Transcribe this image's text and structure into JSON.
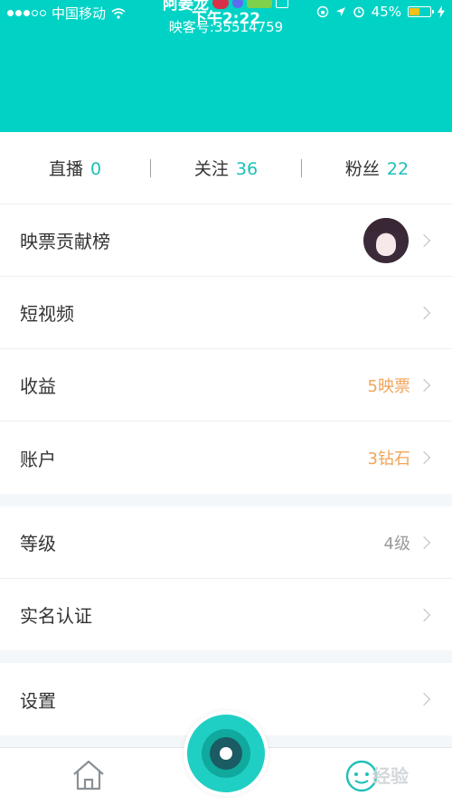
{
  "status_bar": {
    "carrier": "中国移动",
    "time": "下午2:22",
    "battery": "45%"
  },
  "profile": {
    "name": "阿姜龙",
    "id": "映客号:35514759"
  },
  "stats": [
    {
      "label": "直播",
      "value": "0"
    },
    {
      "label": "关注",
      "value": "36"
    },
    {
      "label": "粉丝",
      "value": "22"
    }
  ],
  "menu": {
    "contribution": {
      "label": "映票贡献榜"
    },
    "short_video": {
      "label": "短视频"
    },
    "earnings": {
      "label": "收益",
      "value": "5映票"
    },
    "account": {
      "label": "账户",
      "value": "3钻石"
    },
    "level": {
      "label": "等级",
      "value": "4级"
    },
    "verification": {
      "label": "实名认证"
    },
    "settings": {
      "label": "设置"
    }
  },
  "colors": {
    "header": "#00d3c5",
    "accent_number": "#1ec0b8",
    "value_orange": "#f0a45a"
  },
  "watermark": "经验"
}
